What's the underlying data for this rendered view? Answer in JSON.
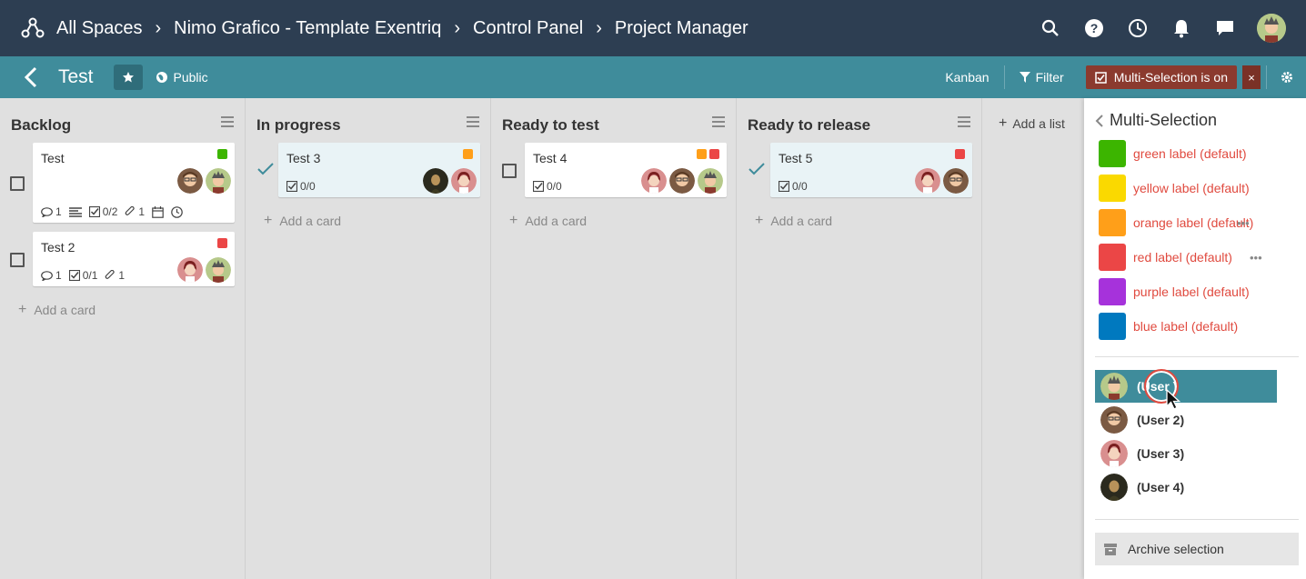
{
  "topbar": {
    "breadcrumbs": [
      "All Spaces",
      "Nimo Grafico - Template Exentriq",
      "Control Panel",
      "Project Manager"
    ],
    "icons": [
      "search-icon",
      "help-icon",
      "clock-icon",
      "bell-icon",
      "chat-icon"
    ]
  },
  "board": {
    "title": "Test",
    "visibility": "Public",
    "view": "Kanban",
    "filter": "Filter",
    "multi_selection": "Multi-Selection is on",
    "close": "×"
  },
  "colors": {
    "topbar": "#2d3e52",
    "boardbar": "#3f8c9b",
    "green": "#3cb500",
    "yellow": "#fad900",
    "orange": "#ff9f19",
    "red": "#eb4646",
    "purple": "#a632db",
    "blue": "#0079bf"
  },
  "lists": [
    {
      "title": "Backlog",
      "cards": [
        {
          "title": "Test",
          "comments": "1",
          "checklist": "0/2",
          "attachments": "1"
        },
        {
          "title": "Test 2",
          "comments": "1",
          "checklist": "0/1",
          "attachments": "1"
        }
      ],
      "add_card": "Add a card"
    },
    {
      "title": "In progress",
      "cards": [
        {
          "title": "Test 3",
          "checklist": "0/0"
        }
      ],
      "add_card": "Add a card"
    },
    {
      "title": "Ready to test",
      "cards": [
        {
          "title": "Test 4",
          "checklist": "0/0"
        }
      ],
      "add_card": "Add a card"
    },
    {
      "title": "Ready to release",
      "cards": [
        {
          "title": "Test 5",
          "checklist": "0/0"
        }
      ],
      "add_card": "Add a card"
    }
  ],
  "add_list": "Add a list",
  "sidebar": {
    "title": "Multi-Selection",
    "labels": [
      {
        "name": "green label (default)",
        "color": "#3cb500"
      },
      {
        "name": "yellow label (default)",
        "color": "#fad900"
      },
      {
        "name": "orange label (default)",
        "color": "#ff9f19"
      },
      {
        "name": "red label (default)",
        "color": "#eb4646"
      },
      {
        "name": "purple label (default)",
        "color": "#a632db"
      },
      {
        "name": "blue label (default)",
        "color": "#0079bf"
      }
    ],
    "more": "•••",
    "members": [
      "(User )",
      "(User 2)",
      "(User 3)",
      "(User 4)"
    ],
    "archive": "Archive selection"
  }
}
